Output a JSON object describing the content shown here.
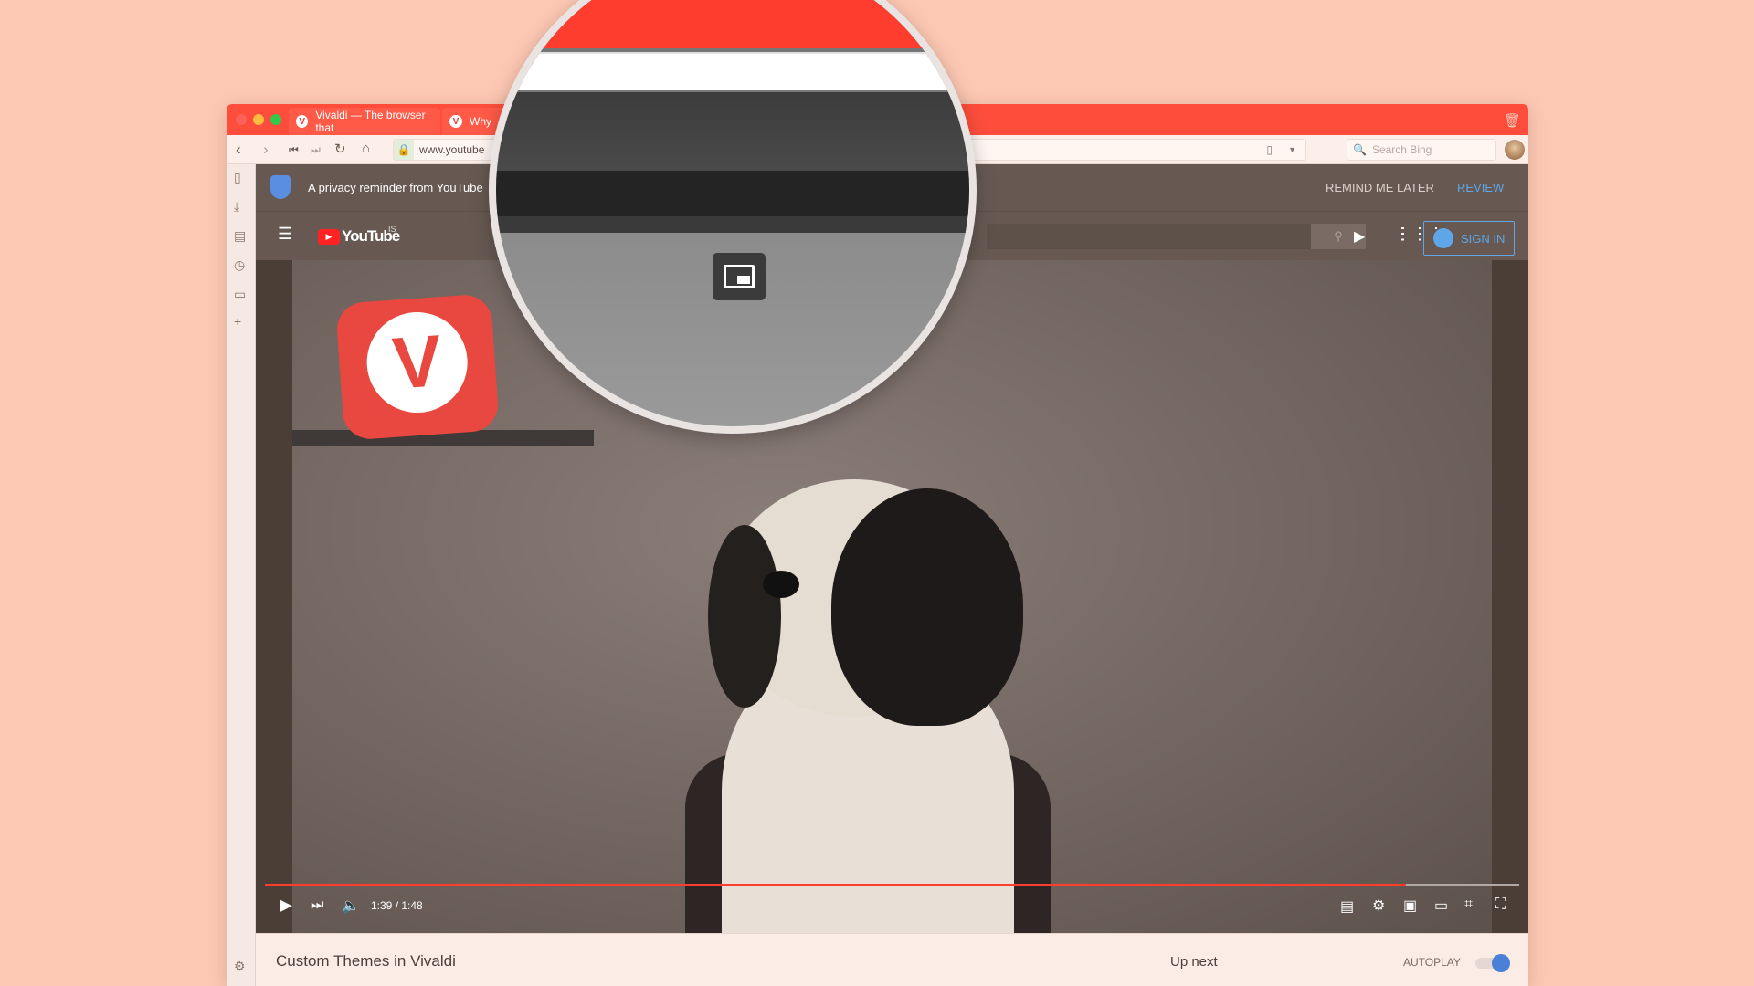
{
  "browser": {
    "tabs": [
      {
        "title": "Vivaldi — The browser that"
      },
      {
        "title": "Why"
      }
    ],
    "url": "www.youtube",
    "search_placeholder": "Search Bing"
  },
  "privacy": {
    "text": "A privacy reminder from YouTube",
    "remind_later": "REMIND ME LATER",
    "review": "REVIEW"
  },
  "youtube": {
    "logo": "YouTube",
    "region": "IS",
    "sign_in": "SIGN IN"
  },
  "player": {
    "time": "1:39 / 1:48",
    "progress_percent": 91,
    "accent": "#ff3d2e"
  },
  "info": {
    "title": "Custom Themes in Vivaldi",
    "up_next": "Up next",
    "autoplay": "AUTOPLAY",
    "autoplay_on": true
  },
  "colors": {
    "background": "#fdc8b3",
    "tabbar": "#fe4d3b",
    "header": "#675952",
    "link": "#5ea6e8"
  }
}
